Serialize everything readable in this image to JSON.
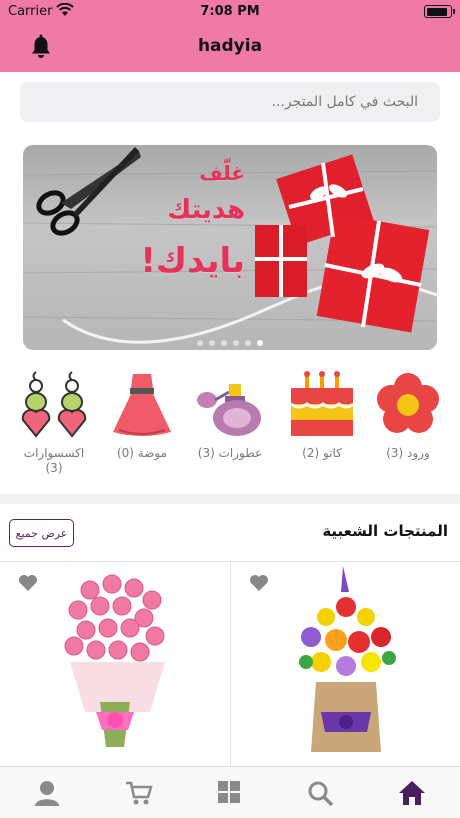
{
  "status": {
    "carrier": "Carrier",
    "time": "7:08 PM",
    "battery_level": 0.95
  },
  "nav": {
    "title": "hadyia",
    "left_icon": "bell-icon"
  },
  "search": {
    "placeholder": "البحث في كامل المتجر..."
  },
  "banner": {
    "line1": "غلّف",
    "line2": "هديتك",
    "line3": "بايدك!",
    "slide_count": 6,
    "active_slide": 6
  },
  "categories": [
    {
      "label": "ورود (3)",
      "icon": "flower-icon"
    },
    {
      "label": "كاتو (2)",
      "icon": "cake-icon"
    },
    {
      "label": "عطورات (3)",
      "icon": "perfume-icon"
    },
    {
      "label": "موضة (0)",
      "icon": "dress-icon"
    },
    {
      "label": "اكسسوارات (3)",
      "icon": "earrings-icon"
    }
  ],
  "popular": {
    "title": "المنتجات الشعبية",
    "view_all": "عرض جميع"
  },
  "products": [
    {
      "name": "mixed-flower-bouquet",
      "icon": "heart-icon"
    },
    {
      "name": "pink-rose-bouquet",
      "icon": "heart-icon"
    }
  ],
  "tabs": [
    {
      "name": "home",
      "icon": "home-icon",
      "active": true
    },
    {
      "name": "search",
      "icon": "search-icon",
      "active": false
    },
    {
      "name": "categories",
      "icon": "grid-icon",
      "active": false
    },
    {
      "name": "cart",
      "icon": "cart-icon",
      "active": false
    },
    {
      "name": "account",
      "icon": "user-icon",
      "active": false
    }
  ],
  "colors": {
    "header": "#f07aa6",
    "accent": "#5b2563",
    "active_tab": "#4a1f5e",
    "inactive_tab": "#8a8a8a"
  }
}
